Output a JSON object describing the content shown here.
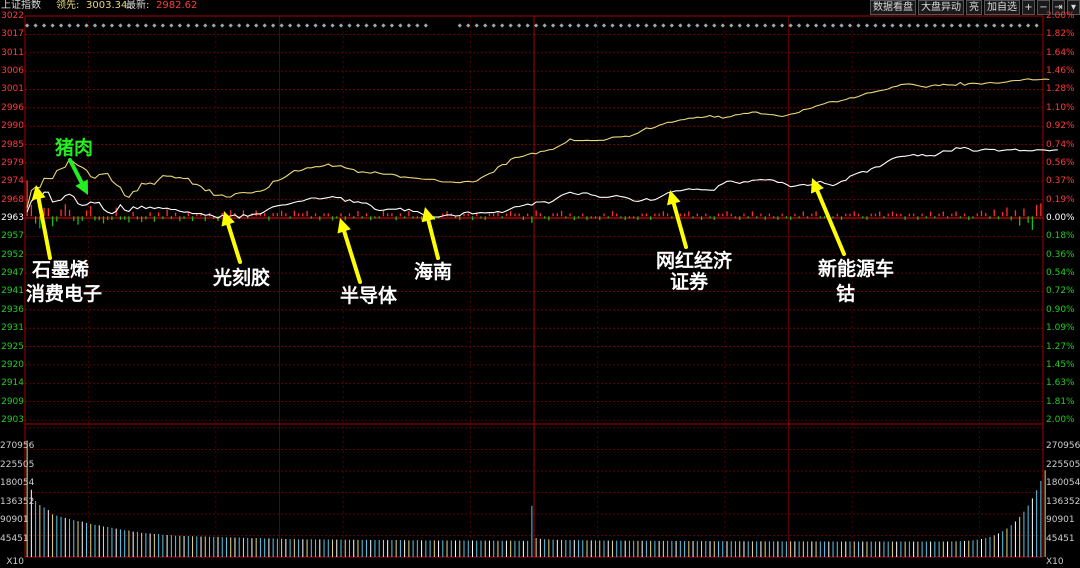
{
  "header": {
    "index_name": "上证指数",
    "lead_label": "领先:",
    "lead_value": "3003.34",
    "latest_label": "最新:",
    "latest_value": "2982.62"
  },
  "toolbar": {
    "btn_data": "数据看盘",
    "btn_market": "大盘异动",
    "btn_light": "亮",
    "btn_add": "加自选",
    "icon_plus": "+",
    "icon_minus": "−",
    "icon_next": "⇥",
    "icon_dropdown": "▾"
  },
  "price_axis": {
    "prev_close": 2963,
    "left_ticks": [
      "3022",
      "3017",
      "3011",
      "3006",
      "3001",
      "2996",
      "2990",
      "2985",
      "2979",
      "2974",
      "2968",
      "2963",
      "2957",
      "2952",
      "2947",
      "2941",
      "2936",
      "2931",
      "2925",
      "2920",
      "2914",
      "2909",
      "2903"
    ],
    "right_ticks": [
      "2.00%",
      "1.82%",
      "1.64%",
      "1.46%",
      "1.28%",
      "1.10%",
      "0.92%",
      "0.74%",
      "0.56%",
      "0.37%",
      "0.19%",
      "0.00%",
      "0.18%",
      "0.36%",
      "0.54%",
      "0.72%",
      "0.90%",
      "1.09%",
      "1.27%",
      "1.45%",
      "1.63%",
      "1.81%",
      "2.00%"
    ]
  },
  "volume_axis": {
    "ticks": [
      "270956",
      "225505",
      "180054",
      "136352",
      "90901",
      "45451"
    ],
    "unit": "X10"
  },
  "annotations": {
    "pork": "猪肉",
    "graphene": "石墨烯",
    "consumer_electronics": "消费电子",
    "photoresist": "光刻胶",
    "semiconductor": "半导体",
    "hainan": "海南",
    "influencer_economy": "网红经济",
    "securities": "证券",
    "new_energy_vehicle": "新能源车",
    "cobalt": "钴"
  },
  "colors": {
    "up": "#ff3030",
    "down": "#12c212",
    "grid": "#7a0000",
    "lead_line": "#e8d878",
    "latest_line": "#ffffff",
    "arrow": "#ffff00",
    "pork_arrow": "#22ee22",
    "axis_text_red": "#ff3a3a",
    "axis_text_green": "#22cc22",
    "volume_text": "#ccc"
  },
  "chart_data": {
    "type": "line",
    "title": "上证指数",
    "x_sessions": 240,
    "ylim": [
      2903,
      3022
    ],
    "series": [
      {
        "name": "领先",
        "color": "#e8d878",
        "values": [
          2965.5,
          2970.6,
          2971.6,
          2971.4,
          2974.2,
          2974.1,
          2974.1,
          2976.5,
          2977.0,
          2977.5,
          2979.9,
          2978.9,
          2978.0,
          2977.4,
          2976.6,
          2974.7,
          2974.2,
          2975.3,
          2975.5,
          2975.6,
          2973.4,
          2972.3,
          2971.5,
          2969.1,
          2968.6,
          2970.3,
          2970.5,
          2972.7,
          2972.5,
          2972.8,
          2972.4,
          2973.8,
          2975.0,
          2974.8,
          2974.8,
          2974.3,
          2974.4,
          2974.1,
          2974.2,
          2972.5,
          2972.4,
          2971.8,
          2970.5,
          2970.8,
          2969.2,
          2969.2,
          2969.3,
          2968.7,
          2968.7,
          2969.6,
          2969.9,
          2970.0,
          2969.9,
          2969.9,
          2970.3,
          2970.4,
          2970.8,
          2971.6,
          2973.3,
          2973.5,
          2974.0,
          2974.7,
          2975.6,
          2976.5,
          2976.3,
          2976.7,
          2977.3,
          2977.3,
          2977.6,
          2977.6,
          2977.9,
          2978.4,
          2977.7,
          2977.8,
          2977.9,
          2977.3,
          2977.0,
          2976.8,
          2975.9,
          2976.1,
          2975.9,
          2975.7,
          2976.1,
          2975.7,
          2975.4,
          2975.4,
          2975.4,
          2975.1,
          2974.5,
          2974.6,
          2974.4,
          2974.3,
          2974.2,
          2974.0,
          2973.9,
          2973.9,
          2973.9,
          2973.4,
          2973.1,
          2973.1,
          2973.1,
          2973.0,
          2972.9,
          2973.2,
          2973.3,
          2973.1,
          2973.4,
          2974.3,
          2975.0,
          2975.6,
          2976.0,
          2977.5,
          2978.2,
          2978.3,
          2979.8,
          2980.3,
          2980.4,
          2980.7,
          2981.2,
          2981.6,
          2981.4,
          2982.1,
          2982.2,
          2982.6,
          2982.7,
          2983.4,
          2984.1,
          2984.7,
          2985.8,
          2985.3,
          2985.3,
          2985.3,
          2985.4,
          2985.3,
          2985.3,
          2985.4,
          2985.4,
          2985.8,
          2986.3,
          2986.4,
          2986.4,
          2986.6,
          2986.5,
          2987.0,
          2987.5,
          2988.3,
          2989.0,
          2988.8,
          2989.2,
          2989.8,
          2990.2,
          2990.7,
          2990.7,
          2991.0,
          2991.4,
          2991.5,
          2991.9,
          2991.9,
          2992.2,
          2992.1,
          2992.3,
          2992.7,
          2992.2,
          2992.5,
          2991.9,
          2992.2,
          2992.4,
          2992.9,
          2993.0,
          2993.3,
          2993.3,
          2993.7,
          2993.7,
          2993.2,
          2993.1,
          2993.0,
          2992.9,
          2992.6,
          2992.4,
          2992.7,
          2993.1,
          2993.3,
          2993.6,
          2994.4,
          2994.6,
          2994.9,
          2995.5,
          2995.8,
          2996.2,
          2996.7,
          2996.8,
          2996.7,
          2997.1,
          2997.4,
          2997.9,
          2997.9,
          2998.3,
          2998.8,
          2999.3,
          2999.4,
          2999.7,
          3000.0,
          3000.2,
          3000.5,
          3001.1,
          3001.3,
          3001.8,
          3001.9,
          3002.0,
          3001.8,
          3001.5,
          3001.2,
          3001.0,
          3001.4,
          3001.7,
          3001.5,
          3001.9,
          3001.7,
          3001.7,
          3001.6,
          3002.4,
          3001.6,
          3002.1,
          3002.2,
          3002.1,
          3001.9,
          3002.2,
          3002.4,
          3002.3,
          3002.2,
          3002.4,
          3002.6,
          3002.9,
          3003.0,
          3003.0,
          3003.3,
          3003.5,
          3003.2,
          3003.2,
          3003.3,
          3003.4,
          3003.3
        ]
      },
      {
        "name": "最新",
        "color": "#ffffff",
        "values": [
          2964.3,
          2967.5,
          2968.4,
          2968.1,
          2970.1,
          2970.1,
          2967.2,
          2967.5,
          2967.8,
          2969.1,
          2969.5,
          2968.8,
          2966.7,
          2966.2,
          2966.4,
          2967.2,
          2966.9,
          2967.1,
          2965.1,
          2964.2,
          2963.8,
          2964.5,
          2966.4,
          2964.8,
          2964.4,
          2965.8,
          2965.2,
          2966.0,
          2965.3,
          2965.7,
          2965.3,
          2965.6,
          2965.3,
          2965.4,
          2965.0,
          2965.0,
          2964.5,
          2964.2,
          2964.3,
          2963.8,
          2963.8,
          2963.8,
          2963.3,
          2963.5,
          2963.0,
          2962.5,
          2963.3,
          2962.9,
          2963.1,
          2963.4,
          2962.5,
          2963.5,
          2963.0,
          2963.5,
          2963.7,
          2963.7,
          2964.4,
          2965.2,
          2965.8,
          2966.1,
          2966.3,
          2966.4,
          2966.7,
          2967.1,
          2967.4,
          2967.5,
          2968.0,
          2968.4,
          2968.4,
          2968.1,
          2968.3,
          2968.5,
          2968.8,
          2968.5,
          2968.5,
          2967.4,
          2967.9,
          2967.1,
          2967.3,
          2966.9,
          2966.9,
          2966.2,
          2965.1,
          2964.7,
          2964.8,
          2965.1,
          2965.1,
          2965.1,
          2965.4,
          2964.6,
          2965.1,
          2964.4,
          2964.4,
          2963.8,
          2962.9,
          2963.0,
          2962.8,
          2962.8,
          2963.1,
          2963.4,
          2963.4,
          2963.1,
          2963.2,
          2964.1,
          2964.3,
          2963.7,
          2963.9,
          2964.1,
          2964.0,
          2964.1,
          2964.1,
          2964.4,
          2964.1,
          2964.6,
          2965.2,
          2965.8,
          2965.9,
          2966.2,
          2966.6,
          2966.3,
          2967.2,
          2967.2,
          2967.3,
          2966.9,
          2967.5,
          2968.4,
          2969.2,
          2969.7,
          2970.1,
          2969.7,
          2969.4,
          2969.9,
          2969.9,
          2969.3,
          2969.1,
          2968.6,
          2968.6,
          2968.6,
          2968.9,
          2969.1,
          2968.8,
          2968.6,
          2968.2,
          2967.5,
          2967.4,
          2967.7,
          2968.2,
          2967.7,
          2967.9,
          2968.5,
          2969.2,
          2969.9,
          2970.2,
          2970.5,
          2970.5,
          2970.8,
          2971.1,
          2970.9,
          2971.0,
          2970.8,
          2970.8,
          2970.7,
          2970.7,
          2972.0,
          2972.6,
          2973.3,
          2973.4,
          2973.0,
          2972.7,
          2973.2,
          2973.1,
          2973.6,
          2973.7,
          2973.8,
          2973.7,
          2973.8,
          2973.6,
          2973.0,
          2973.0,
          2972.4,
          2971.7,
          2971.9,
          2972.2,
          2972.4,
          2972.1,
          2972.3,
          2972.9,
          2973.3,
          2972.7,
          2972.4,
          2972.0,
          2972.6,
          2973.3,
          2973.6,
          2974.8,
          2975.3,
          2975.8,
          2976.2,
          2976.0,
          2977.0,
          2977.5,
          2977.6,
          2978.4,
          2979.3,
          2980.0,
          2980.4,
          2980.6,
          2980.7,
          2980.9,
          2981.2,
          2980.8,
          2981.2,
          2980.8,
          2980.9,
          2980.8,
          2981.5,
          2982.3,
          2982.2,
          2982.2,
          2983.2,
          2983.0,
          2983.3,
          2982.9,
          2982.2,
          2982.2,
          2982.6,
          2982.8,
          2982.7,
          2982.7,
          2982.2,
          2982.4,
          2982.6,
          2982.6,
          2982.8,
          2982.3,
          2982.4,
          2982.3,
          2982.3,
          2982.6,
          2982.6,
          2982.5,
          2982.3,
          2982.5,
          2982.6
        ]
      }
    ],
    "volume": {
      "ylim": [
        0,
        300000
      ],
      "values": [
        270956,
        156440,
        130150,
        120810,
        115240,
        109020,
        99160,
        96330,
        93550,
        90970,
        88580,
        85680,
        83330,
        82360,
        79350,
        76830,
        74860,
        73640,
        71100,
        69840,
        67950,
        66000,
        64260,
        62200,
        61570,
        59190,
        58540,
        56250,
        55640,
        54540,
        53690,
        53150,
        51600,
        51200,
        50930,
        49650,
        49550,
        48900,
        48860,
        48360,
        47970,
        47450,
        47550,
        47010,
        46940,
        46830,
        45960,
        45860,
        45470,
        44980,
        45530,
        44580,
        44310,
        43680,
        44040,
        43910,
        43140,
        43260,
        43370,
        42400,
        42390,
        41810,
        41580,
        41760,
        41140,
        41260,
        40760,
        41360,
        40760,
        41020,
        40700,
        40740,
        40590,
        40490,
        40340,
        40320,
        40310,
        40360,
        39940,
        39940,
        40220,
        39490,
        39560,
        39730,
        39680,
        39220,
        39430,
        39480,
        39560,
        39030,
        38660,
        38780,
        39250,
        38710,
        38540,
        38700,
        38740,
        38290,
        38740,
        38440,
        38630,
        38500,
        38450,
        38390,
        38180,
        38370,
        38120,
        38200,
        38160,
        38110,
        37990,
        37870,
        37790,
        38010,
        37980,
        37590,
        37720,
        37450,
        37830,
        119000,
        44000,
        42000,
        41500,
        41000,
        40500,
        40000,
        39800,
        39600,
        39400,
        39200,
        39000,
        38900,
        38800,
        38700,
        38600,
        38500,
        38400,
        38300,
        38200,
        38100,
        38000,
        38000,
        37900,
        37800,
        37700,
        37700,
        37600,
        37500,
        37500,
        37400,
        37400,
        37300,
        37300,
        37200,
        37200,
        37100,
        37100,
        37000,
        37000,
        36900,
        36900,
        36900,
        36800,
        36800,
        36800,
        36700,
        36700,
        36700,
        36600,
        36600,
        36600,
        36500,
        36500,
        36500,
        36400,
        36400,
        36400,
        36400,
        36300,
        36300,
        36300,
        36300,
        36200,
        36200,
        36200,
        36200,
        36100,
        36100,
        36100,
        36100,
        36100,
        36000,
        36000,
        36000,
        36000,
        36000,
        36000,
        35900,
        35900,
        35900,
        35900,
        35900,
        35900,
        35900,
        35900,
        35900,
        35900,
        35900,
        35900,
        35900,
        35900,
        35900,
        35900,
        35900,
        35900,
        36000,
        36000,
        36000,
        36200,
        36400,
        36800,
        37300,
        38000,
        39000,
        40300,
        42000,
        44200,
        47000,
        50500,
        54800,
        60000,
        66300,
        73800,
        82700,
        93200,
        105500,
        119800,
        136300,
        155300,
        177000,
        201700
      ]
    }
  }
}
